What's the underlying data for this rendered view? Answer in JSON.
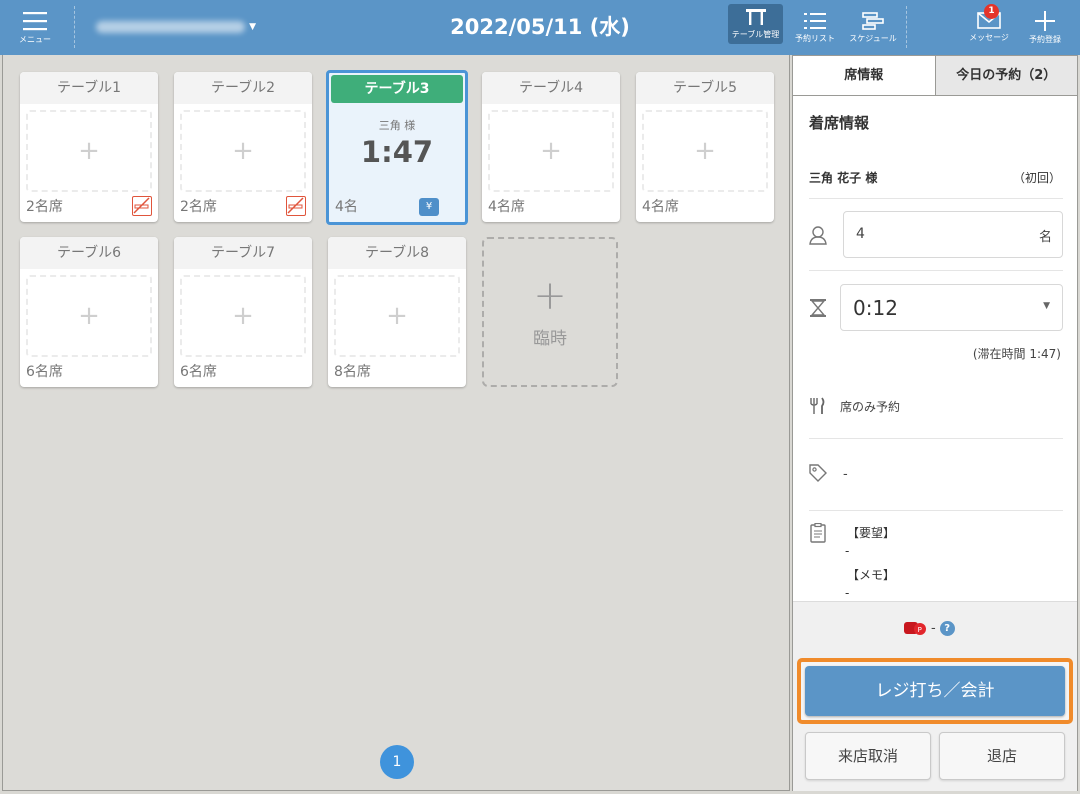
{
  "header": {
    "menu_label": "メニュー",
    "date": "2022/05/11 (水)",
    "nav": [
      {
        "label": "テーブル管理",
        "icon": "table-icon"
      },
      {
        "label": "予約リスト",
        "icon": "list-icon"
      },
      {
        "label": "スケジュール",
        "icon": "schedule-icon"
      },
      {
        "label": "メッセージ",
        "icon": "message-icon",
        "badge": "1"
      },
      {
        "label": "予約登録",
        "icon": "plus-icon"
      }
    ]
  },
  "tables": [
    {
      "name": "テーブル1",
      "seats": "2名席",
      "no_smoking": true
    },
    {
      "name": "テーブル2",
      "seats": "2名席",
      "no_smoking": true
    },
    {
      "name": "テーブル3",
      "seats": "4名",
      "guest": "三角 様",
      "elapsed": "1:47",
      "selected": true
    },
    {
      "name": "テーブル4",
      "seats": "4名席"
    },
    {
      "name": "テーブル5",
      "seats": "4名席"
    },
    {
      "name": "テーブル6",
      "seats": "6名席"
    },
    {
      "name": "テーブル7",
      "seats": "6名席"
    },
    {
      "name": "テーブル8",
      "seats": "8名席"
    }
  ],
  "temp_table": {
    "plus": "+",
    "label": "臨時"
  },
  "empty_slot": "+",
  "pager": {
    "current": "1"
  },
  "panel": {
    "tabs": [
      {
        "label": "席情報",
        "active": true
      },
      {
        "label": "今日の予約（2）",
        "active": false
      }
    ],
    "section_title": "着席情報",
    "guest_name": "三角 花子 様",
    "visit": "（初回）",
    "party_size": "4",
    "party_unit": "名",
    "time_value": "0:12",
    "stay_time": "(滞在時間 1:47)",
    "course": "席のみ予約",
    "tag": "-",
    "notes": {
      "request_label": "【要望】",
      "request_value": "-",
      "memo_label": "【メモ】",
      "memo_value": "-"
    },
    "points": {
      "value": "-",
      "help": "?"
    },
    "buttons": {
      "pay": "レジ打ち／会計",
      "cancel_visit": "来店取消",
      "leave": "退店"
    }
  },
  "colors": {
    "header": "#5b95c7",
    "selected_table": "#3fae7a",
    "pay_highlight": "#f08b2b",
    "pager": "#3f93dc"
  }
}
